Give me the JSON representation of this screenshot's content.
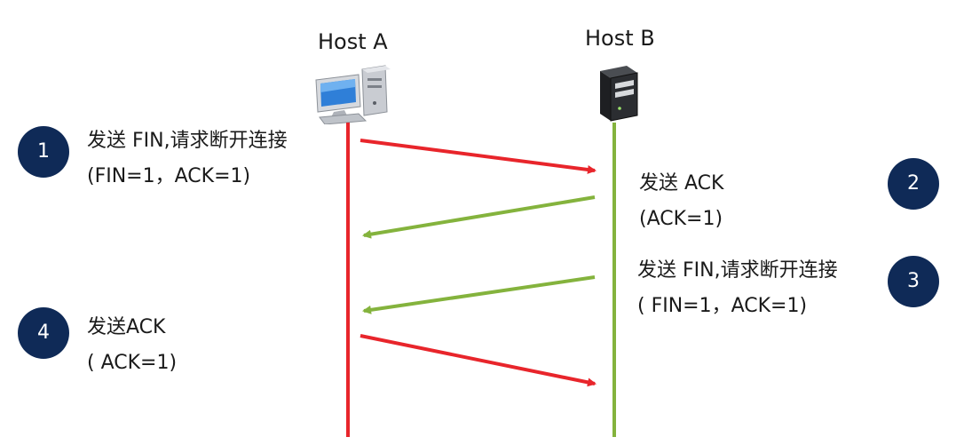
{
  "hosts": {
    "a": {
      "label": "Host A",
      "icon": "desktop-computer-icon"
    },
    "b": {
      "label": "Host B",
      "icon": "server-tower-icon"
    }
  },
  "colors": {
    "host_a_line": "#e8252b",
    "host_b_line": "#84b33d",
    "badge": "#0f2a57"
  },
  "steps": [
    {
      "number": "1",
      "line1": "发送 FIN,请求断开连接",
      "line2": "(FIN=1，ACK=1)",
      "direction": "A-to-B"
    },
    {
      "number": "2",
      "line1": "发送 ACK",
      "line2": "(ACK=1)",
      "direction": "B-to-A"
    },
    {
      "number": "3",
      "line1": "发送 FIN,请求断开连接",
      "line2": "( FIN=1，ACK=1)",
      "direction": "B-to-A"
    },
    {
      "number": "4",
      "line1": "发送ACK",
      "line2": "( ACK=1)",
      "direction": "A-to-B"
    }
  ]
}
